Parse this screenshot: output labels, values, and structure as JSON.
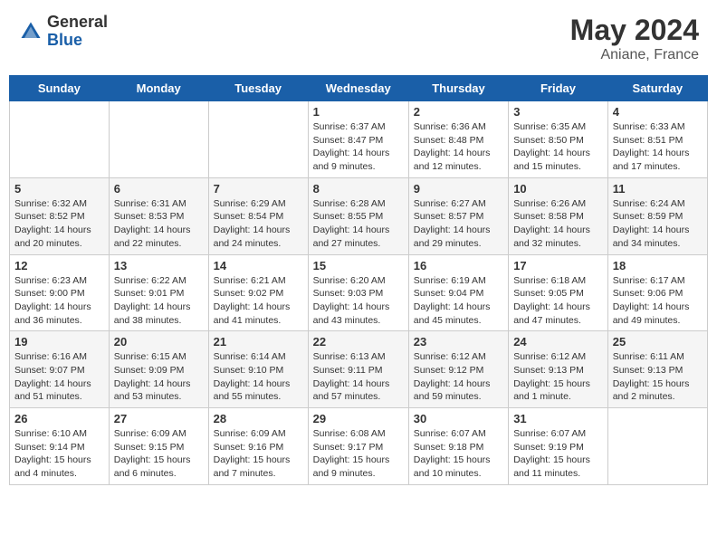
{
  "header": {
    "logo_general": "General",
    "logo_blue": "Blue",
    "title": "May 2024",
    "location": "Aniane, France"
  },
  "days_of_week": [
    "Sunday",
    "Monday",
    "Tuesday",
    "Wednesday",
    "Thursday",
    "Friday",
    "Saturday"
  ],
  "weeks": [
    [
      {
        "day": "",
        "info": ""
      },
      {
        "day": "",
        "info": ""
      },
      {
        "day": "",
        "info": ""
      },
      {
        "day": "1",
        "info": "Sunrise: 6:37 AM\nSunset: 8:47 PM\nDaylight: 14 hours\nand 9 minutes."
      },
      {
        "day": "2",
        "info": "Sunrise: 6:36 AM\nSunset: 8:48 PM\nDaylight: 14 hours\nand 12 minutes."
      },
      {
        "day": "3",
        "info": "Sunrise: 6:35 AM\nSunset: 8:50 PM\nDaylight: 14 hours\nand 15 minutes."
      },
      {
        "day": "4",
        "info": "Sunrise: 6:33 AM\nSunset: 8:51 PM\nDaylight: 14 hours\nand 17 minutes."
      }
    ],
    [
      {
        "day": "5",
        "info": "Sunrise: 6:32 AM\nSunset: 8:52 PM\nDaylight: 14 hours\nand 20 minutes."
      },
      {
        "day": "6",
        "info": "Sunrise: 6:31 AM\nSunset: 8:53 PM\nDaylight: 14 hours\nand 22 minutes."
      },
      {
        "day": "7",
        "info": "Sunrise: 6:29 AM\nSunset: 8:54 PM\nDaylight: 14 hours\nand 24 minutes."
      },
      {
        "day": "8",
        "info": "Sunrise: 6:28 AM\nSunset: 8:55 PM\nDaylight: 14 hours\nand 27 minutes."
      },
      {
        "day": "9",
        "info": "Sunrise: 6:27 AM\nSunset: 8:57 PM\nDaylight: 14 hours\nand 29 minutes."
      },
      {
        "day": "10",
        "info": "Sunrise: 6:26 AM\nSunset: 8:58 PM\nDaylight: 14 hours\nand 32 minutes."
      },
      {
        "day": "11",
        "info": "Sunrise: 6:24 AM\nSunset: 8:59 PM\nDaylight: 14 hours\nand 34 minutes."
      }
    ],
    [
      {
        "day": "12",
        "info": "Sunrise: 6:23 AM\nSunset: 9:00 PM\nDaylight: 14 hours\nand 36 minutes."
      },
      {
        "day": "13",
        "info": "Sunrise: 6:22 AM\nSunset: 9:01 PM\nDaylight: 14 hours\nand 38 minutes."
      },
      {
        "day": "14",
        "info": "Sunrise: 6:21 AM\nSunset: 9:02 PM\nDaylight: 14 hours\nand 41 minutes."
      },
      {
        "day": "15",
        "info": "Sunrise: 6:20 AM\nSunset: 9:03 PM\nDaylight: 14 hours\nand 43 minutes."
      },
      {
        "day": "16",
        "info": "Sunrise: 6:19 AM\nSunset: 9:04 PM\nDaylight: 14 hours\nand 45 minutes."
      },
      {
        "day": "17",
        "info": "Sunrise: 6:18 AM\nSunset: 9:05 PM\nDaylight: 14 hours\nand 47 minutes."
      },
      {
        "day": "18",
        "info": "Sunrise: 6:17 AM\nSunset: 9:06 PM\nDaylight: 14 hours\nand 49 minutes."
      }
    ],
    [
      {
        "day": "19",
        "info": "Sunrise: 6:16 AM\nSunset: 9:07 PM\nDaylight: 14 hours\nand 51 minutes."
      },
      {
        "day": "20",
        "info": "Sunrise: 6:15 AM\nSunset: 9:09 PM\nDaylight: 14 hours\nand 53 minutes."
      },
      {
        "day": "21",
        "info": "Sunrise: 6:14 AM\nSunset: 9:10 PM\nDaylight: 14 hours\nand 55 minutes."
      },
      {
        "day": "22",
        "info": "Sunrise: 6:13 AM\nSunset: 9:11 PM\nDaylight: 14 hours\nand 57 minutes."
      },
      {
        "day": "23",
        "info": "Sunrise: 6:12 AM\nSunset: 9:12 PM\nDaylight: 14 hours\nand 59 minutes."
      },
      {
        "day": "24",
        "info": "Sunrise: 6:12 AM\nSunset: 9:13 PM\nDaylight: 15 hours\nand 1 minute."
      },
      {
        "day": "25",
        "info": "Sunrise: 6:11 AM\nSunset: 9:13 PM\nDaylight: 15 hours\nand 2 minutes."
      }
    ],
    [
      {
        "day": "26",
        "info": "Sunrise: 6:10 AM\nSunset: 9:14 PM\nDaylight: 15 hours\nand 4 minutes."
      },
      {
        "day": "27",
        "info": "Sunrise: 6:09 AM\nSunset: 9:15 PM\nDaylight: 15 hours\nand 6 minutes."
      },
      {
        "day": "28",
        "info": "Sunrise: 6:09 AM\nSunset: 9:16 PM\nDaylight: 15 hours\nand 7 minutes."
      },
      {
        "day": "29",
        "info": "Sunrise: 6:08 AM\nSunset: 9:17 PM\nDaylight: 15 hours\nand 9 minutes."
      },
      {
        "day": "30",
        "info": "Sunrise: 6:07 AM\nSunset: 9:18 PM\nDaylight: 15 hours\nand 10 minutes."
      },
      {
        "day": "31",
        "info": "Sunrise: 6:07 AM\nSunset: 9:19 PM\nDaylight: 15 hours\nand 11 minutes."
      },
      {
        "day": "",
        "info": ""
      }
    ]
  ]
}
